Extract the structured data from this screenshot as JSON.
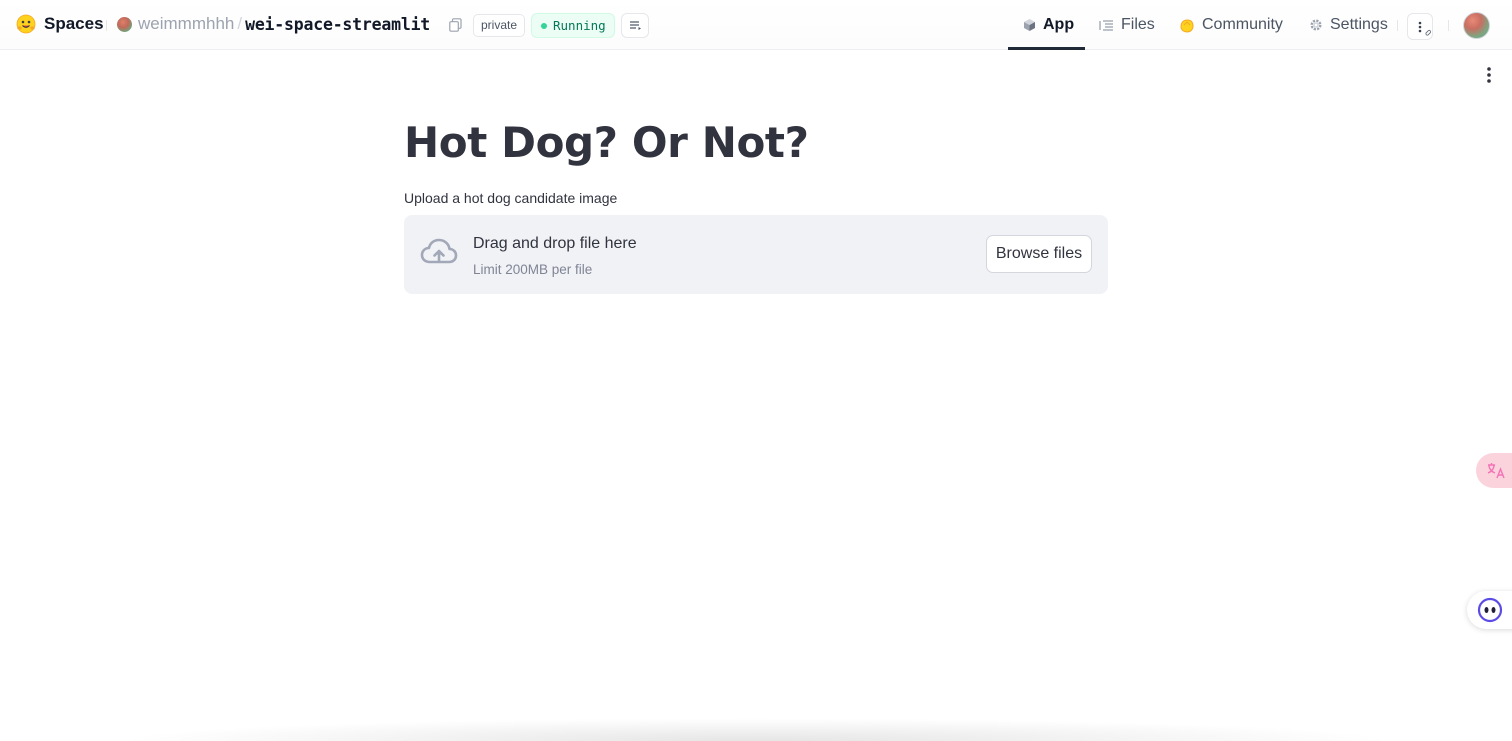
{
  "header": {
    "brand": "Spaces",
    "owner": "weimmmhhh",
    "separator": "/",
    "space_name": "wei-space-streamlit",
    "visibility_badge": "private",
    "status_badge": "Running",
    "status_color": "#34d399",
    "tabs": [
      {
        "label": "App",
        "icon": "cube-icon",
        "active": true
      },
      {
        "label": "Files",
        "icon": "files-icon",
        "active": false
      },
      {
        "label": "Community",
        "icon": "community-hand-icon",
        "active": false
      },
      {
        "label": "Settings",
        "icon": "gear-icon",
        "active": false
      }
    ]
  },
  "app": {
    "title": "Hot Dog? Or Not?",
    "uploader": {
      "label": "Upload a hot dog candidate image",
      "drop_title": "Drag and drop file here",
      "limit_text": "Limit 200MB per file",
      "button_label": "Browse files"
    }
  },
  "colors": {
    "title_text": "#31333f",
    "dropzone_bg": "#f0f2f6",
    "running_bg": "#ecfdf5",
    "running_text": "#047857"
  }
}
